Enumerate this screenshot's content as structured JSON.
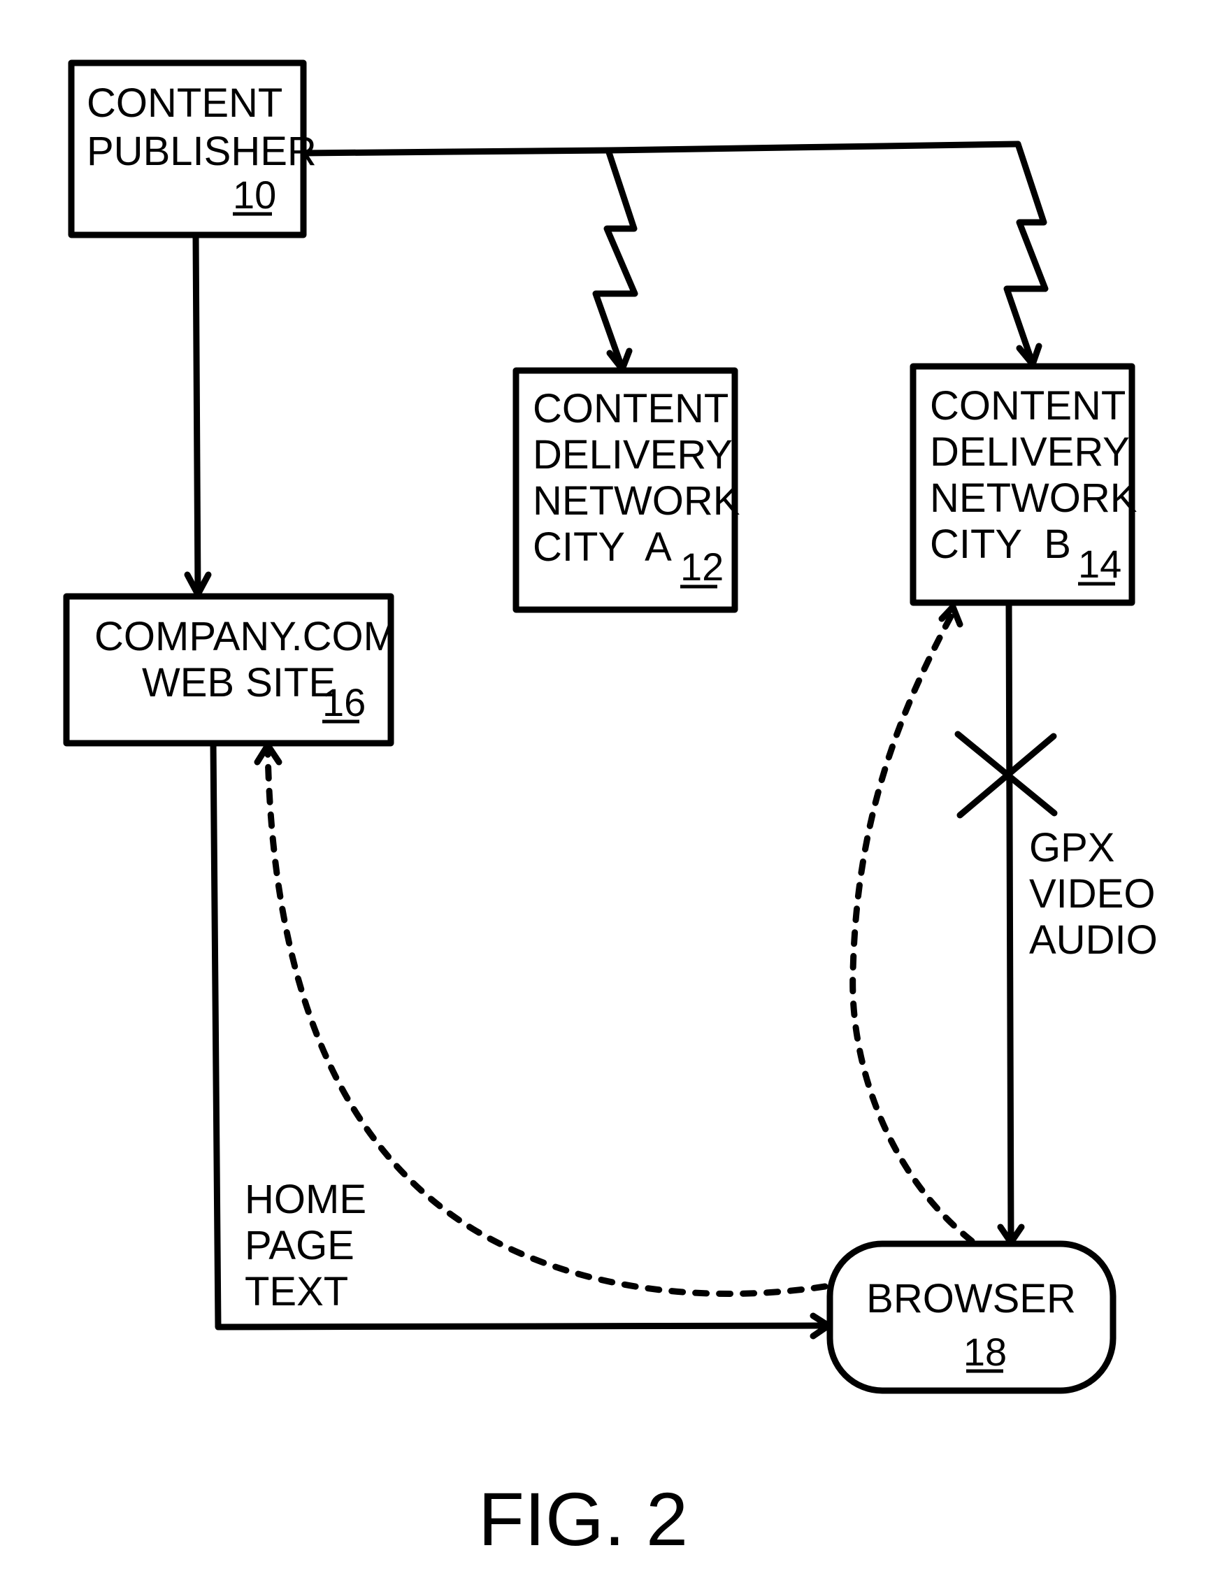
{
  "figure": {
    "caption": "FIG. 2",
    "nodes": {
      "content_publisher": {
        "lines": [
          "CONTENT",
          "PUBLISHER"
        ],
        "ref": "10"
      },
      "cdn_city_a": {
        "lines": [
          "CONTENT",
          "DELIVERY",
          "NETWORK",
          "CITY  A"
        ],
        "ref": "12"
      },
      "cdn_city_b": {
        "lines": [
          "CONTENT",
          "DELIVERY",
          "NETWORK",
          "CITY  B"
        ],
        "ref": "14"
      },
      "company_website": {
        "lines": [
          "COMPANY.COM",
          "WEB SITE"
        ],
        "ref": "16"
      },
      "browser": {
        "lines": [
          "BROWSER"
        ],
        "ref": "18"
      }
    },
    "edge_labels": {
      "cdn_b_to_browser": [
        "GPX",
        "VIDEO",
        "AUDIO"
      ],
      "website_to_browser": [
        "HOME",
        "PAGE",
        "TEXT"
      ]
    },
    "edges": [
      {
        "from": "content_publisher",
        "to": "company_website",
        "style": "solid"
      },
      {
        "from": "content_publisher",
        "to": "cdn_city_a",
        "style": "lightning"
      },
      {
        "from": "content_publisher",
        "to": "cdn_city_b",
        "style": "lightning"
      },
      {
        "from": "cdn_city_b",
        "to": "browser",
        "style": "solid-blocked"
      },
      {
        "from": "company_website",
        "to": "browser",
        "style": "solid"
      },
      {
        "from": "browser",
        "to": "company_website",
        "style": "dashed"
      },
      {
        "from": "browser",
        "to": "cdn_city_b",
        "style": "dashed"
      }
    ]
  }
}
